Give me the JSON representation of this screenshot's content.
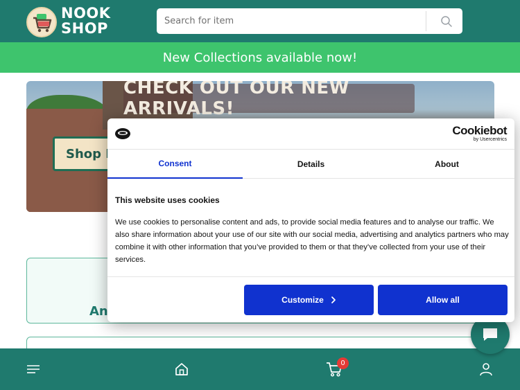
{
  "header": {
    "logo_line1": "NOOK",
    "logo_line2": "SHOP",
    "search_placeholder": "Search for item",
    "icons": [
      "shopping-cart-logo-icon",
      "search-icon"
    ]
  },
  "promo": {
    "text": "New Collections available now!"
  },
  "banner": {
    "title": "CHECK OUT OUR NEW ARRIVALS!",
    "button_label": "Shop N"
  },
  "card1": {
    "text": "An"
  },
  "cookie_dialog": {
    "brand_name": "Cookiebot",
    "brand_sub": "by Usercentrics",
    "tabs": [
      {
        "label": "Consent",
        "active": true
      },
      {
        "label": "Details",
        "active": false
      },
      {
        "label": "About",
        "active": false
      }
    ],
    "heading": "This website uses cookies",
    "body": "We use cookies to personalise content and ads, to provide social media features and to analyse our traffic. We also share information about your use of our site with our social media, advertising and analytics partners who may combine it with other information that you’ve provided to them or that they’ve collected from your use of their services.",
    "customize_label": "Customize",
    "allow_all_label": "Allow all",
    "accent_color": "#1032cf"
  },
  "bottom_nav": {
    "items": [
      "menu-icon",
      "home-icon",
      "cart-icon",
      "user-icon"
    ],
    "cart_count": "0"
  },
  "colors": {
    "header": "#1f7a6e",
    "promo": "#3ec46d",
    "badge": "#e53935"
  }
}
